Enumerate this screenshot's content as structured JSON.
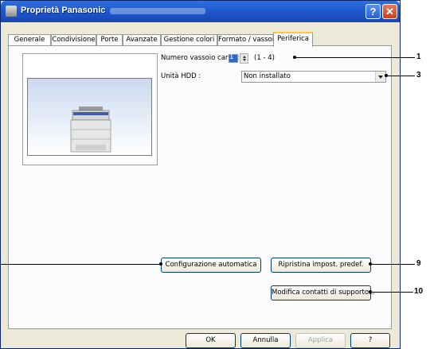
{
  "window": {
    "title": "Proprietà Panasonic",
    "help_button": "?",
    "close_button": "✕"
  },
  "tabs": [
    "Generale",
    "Condivisione",
    "Porte",
    "Avanzate",
    "Gestione colori",
    "Formato / vassoio",
    "Periferica"
  ],
  "active_tab": "Periferica",
  "settings": {
    "tray_label": "Numero vassoio carta :",
    "tray_value": "1",
    "tray_range": "(1 - 4)",
    "hdd_label": "Unità HDD :",
    "hdd_value": "Non installato"
  },
  "buttons": {
    "auto_config": "Configurazione automatica",
    "restore_defaults": "Ripristina impost. predef.",
    "edit_contacts": "Modifica contatti di supporto...",
    "ok": "OK",
    "cancel": "Annulla",
    "apply": "Applica",
    "help": "?"
  },
  "callouts": [
    "1",
    "3",
    "9",
    "10"
  ]
}
